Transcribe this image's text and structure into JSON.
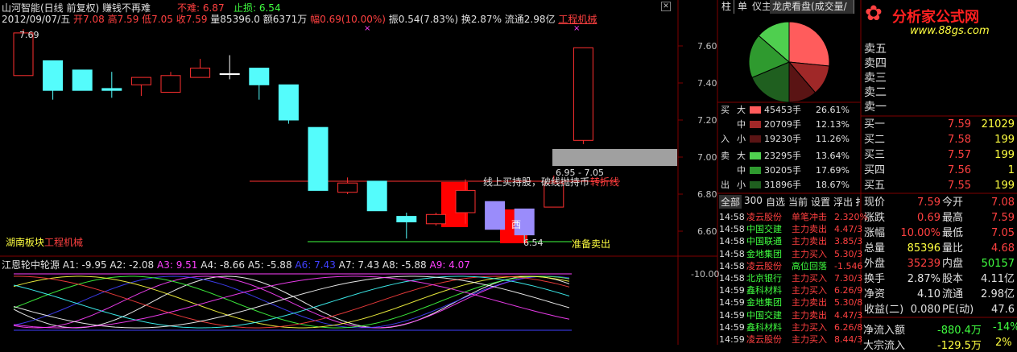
{
  "header": {
    "title": "山河智能(日线 前复权) 赚钱不再难",
    "not_easy_label": "不难: 6.87",
    "stop_loss_label": "止损: 6.54",
    "date": "2012/09/07/五",
    "open": "开7.08",
    "high": "高7.59",
    "low": "低7.05",
    "close": "收7.59",
    "volume": "量85396.0",
    "amount": "额6371万",
    "change": "幅0.69(10.00%)",
    "amplitude": "振0.54(7.83%)",
    "turnover": "换2.87%",
    "float": "流通2.98亿",
    "sector": "工程机械"
  },
  "chart": {
    "price_ticks": [
      "7.60",
      "7.40",
      "7.20",
      "7.00",
      "6.80",
      "6.60"
    ],
    "top_left_price": "7.69",
    "annotation_line": "线上买持股，破线抛持币",
    "annotation_turn": "转折线",
    "gray_box_label": "6.95 - 7.05",
    "marker_label": "西",
    "low_label": "6.54",
    "ready_sell": "准备卖出",
    "sector_label": "湖南板块",
    "sector_value": "工程机械",
    "candles": [
      {
        "o": 7.44,
        "c": 7.67,
        "h": 7.69,
        "l": 7.44
      },
      {
        "o": 7.52,
        "c": 7.36,
        "h": 7.52,
        "l": 7.31
      },
      {
        "o": 7.47,
        "c": 7.36,
        "h": 7.47,
        "l": 7.36
      },
      {
        "o": 7.37,
        "c": 7.36,
        "h": 7.46,
        "l": 7.32
      },
      {
        "o": 7.39,
        "c": 7.43,
        "h": 7.43,
        "l": 7.33
      },
      {
        "o": 7.35,
        "c": 7.44,
        "h": 7.46,
        "l": 7.35
      },
      {
        "o": 7.43,
        "c": 7.48,
        "h": 7.53,
        "l": 7.43
      },
      {
        "o": 7.45,
        "c": 7.45,
        "h": 7.55,
        "l": 7.42
      },
      {
        "o": 7.48,
        "c": 7.39,
        "h": 7.48,
        "l": 7.31
      },
      {
        "o": 7.39,
        "c": 7.2,
        "h": 7.39,
        "l": 7.18
      },
      {
        "o": 7.16,
        "c": 6.82,
        "h": 7.16,
        "l": 6.82
      },
      {
        "o": 6.81,
        "c": 6.86,
        "h": 6.89,
        "l": 6.8
      },
      {
        "o": 6.87,
        "c": 6.71,
        "h": 6.87,
        "l": 6.71
      },
      {
        "o": 6.68,
        "c": 6.65,
        "h": 6.7,
        "l": 6.56
      },
      {
        "o": 6.64,
        "c": 6.69,
        "h": 6.7,
        "l": 6.63
      },
      {
        "o": 6.7,
        "c": 6.82,
        "h": 6.88,
        "l": 6.64
      },
      {
        "o": 6.76,
        "c": 6.61,
        "h": 6.76,
        "l": 6.61
      },
      {
        "o": 6.72,
        "c": 6.58,
        "h": 6.72,
        "l": 6.54
      },
      {
        "o": 6.73,
        "c": 6.86,
        "h": 6.9,
        "l": 6.73
      },
      {
        "o": 7.09,
        "c": 7.59,
        "h": 7.59,
        "l": 7.07
      }
    ]
  },
  "indicator": {
    "name": "江恩轮中轮源",
    "a1": "A1: -9.95",
    "a2": "A2: -2.08",
    "a3": "A3: 9.51",
    "a4": "A4: -8.66",
    "a5": "A5: -5.88",
    "a6": "A6: 7.43",
    "a7": "A7: 7.43",
    "a8": "A8: -5.88",
    "a9": "A9: 4.07",
    "tick": "-10.00"
  },
  "side_tabs": [
    "柱",
    "单",
    "仪主动",
    "龙虎看盘(成交量/"
  ],
  "volume_breakdown": [
    {
      "side": "买",
      "size": "大",
      "lots": "45453手",
      "pct": "26.61%",
      "color": "#ff5c5c"
    },
    {
      "side": "",
      "size": "中",
      "lots": "20709手",
      "pct": "12.13%",
      "color": "#a02828"
    },
    {
      "side": "入",
      "size": "小",
      "lots": "19230手",
      "pct": "11.26%",
      "color": "#5a1414"
    },
    {
      "side": "卖",
      "size": "大",
      "lots": "23295手",
      "pct": "13.64%",
      "color": "#4fcf4f"
    },
    {
      "side": "",
      "size": "中",
      "lots": "30205手",
      "pct": "17.69%",
      "color": "#2f9a2f"
    },
    {
      "side": "出",
      "size": "小",
      "lots": "31896手",
      "pct": "18.67%",
      "color": "#1f5f1f"
    }
  ],
  "ticker_tabs": [
    "全部",
    "300",
    "自选",
    "当前",
    "设置",
    "浮出",
    "扌"
  ],
  "ticker": [
    {
      "time": "14:58",
      "name": "凌云股份",
      "action": "单笔冲击",
      "value": "2.320%"
    },
    {
      "time": "14:58",
      "name": "中国交建",
      "action": "主力卖出",
      "value": "4.47/3"
    },
    {
      "time": "14:58",
      "name": "中国联通",
      "action": "主力卖出",
      "value": "3.85/3"
    },
    {
      "time": "14:58",
      "name": "金地集团",
      "action": "主力买入",
      "value": "5.30/3"
    },
    {
      "time": "14:58",
      "name": "凌云股份",
      "action": "高位回落",
      "value": "-1.546"
    },
    {
      "time": "14:58",
      "name": "北京银行",
      "action": "主力买入",
      "value": "7.30/3"
    },
    {
      "time": "14:59",
      "name": "鑫科材料",
      "action": "主力买入",
      "value": "6.26/9"
    },
    {
      "time": "14:59",
      "name": "金地集团",
      "action": "主力卖出",
      "value": "5.30/8"
    },
    {
      "time": "14:59",
      "name": "中国交建",
      "action": "主力卖出",
      "value": "4.47/3"
    },
    {
      "time": "14:59",
      "name": "鑫科材料",
      "action": "主力买入",
      "value": "6.26/8"
    },
    {
      "time": "14:59",
      "name": "凌云股份",
      "action": "主力买入",
      "value": "8.44/3"
    }
  ],
  "brand": {
    "name": "分析家公式网",
    "url": "www.88gs.com"
  },
  "order_book": {
    "sell_partial": [
      "卖五",
      "卖四",
      "卖三",
      "卖二",
      "卖一"
    ],
    "buy": [
      {
        "label": "买一",
        "price": "7.59",
        "vol": "21029"
      },
      {
        "label": "买二",
        "price": "7.58",
        "vol": "199"
      },
      {
        "label": "买三",
        "price": "7.57",
        "vol": "199"
      },
      {
        "label": "买四",
        "price": "7.56",
        "vol": "1"
      },
      {
        "label": "买五",
        "price": "7.55",
        "vol": "199"
      }
    ]
  },
  "stats": [
    {
      "l1": "现价",
      "v1": "7.59",
      "c1": "#ff4040",
      "l2": "今开",
      "v2": "7.08",
      "c2": "#ff4040"
    },
    {
      "l1": "涨跌",
      "v1": "0.69",
      "c1": "#ff4040",
      "l2": "最高",
      "v2": "7.59",
      "c2": "#ff4040"
    },
    {
      "l1": "涨幅",
      "v1": "10.00%",
      "c1": "#ff4040",
      "l2": "最低",
      "v2": "7.05",
      "c2": "#ff4040"
    },
    {
      "l1": "总量",
      "v1": "85396",
      "c1": "#ffff40",
      "l2": "量比",
      "v2": "4.68",
      "c2": "#ff4040"
    },
    {
      "l1": "外盘",
      "v1": "35239",
      "c1": "#ff4040",
      "l2": "内盘",
      "v2": "50157",
      "c2": "#40ff40"
    },
    {
      "l1": "换手",
      "v1": "2.87%",
      "c1": "#e0e0e0",
      "l2": "股本",
      "v2": "4.11亿",
      "c2": "#e0e0e0"
    },
    {
      "l1": "净资",
      "v1": "4.10",
      "c1": "#e0e0e0",
      "l2": "流通",
      "v2": "2.98亿",
      "c2": "#e0e0e0"
    },
    {
      "l1": "收益(二)",
      "v1": "0.080",
      "c1": "#e0e0e0",
      "l2": "PE(动)",
      "v2": "47.6",
      "c2": "#e0e0e0"
    }
  ],
  "net_inflow": {
    "label": "净流入额",
    "value": "-880.4万",
    "pct": "-14%"
  },
  "large_inflow": {
    "label": "大宗流入",
    "value": "-129.5万",
    "pct": "2%"
  }
}
